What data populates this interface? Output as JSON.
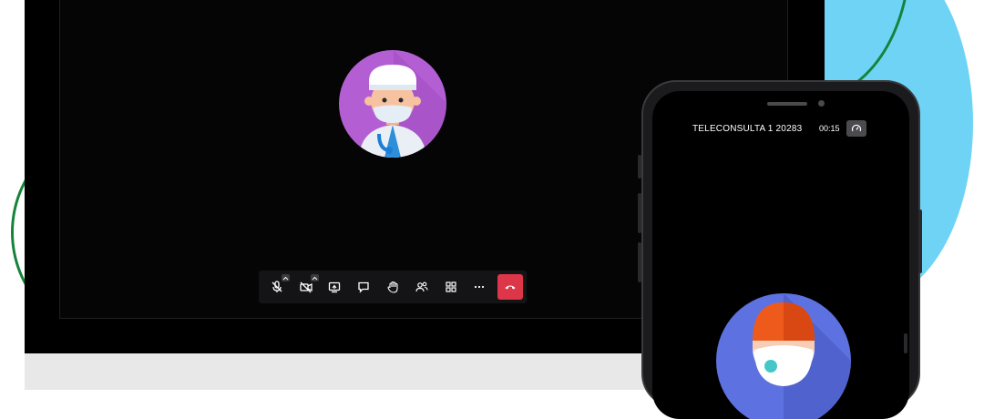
{
  "call": {
    "title": "TELECONSULTA 1 20283",
    "timer": "00:15"
  },
  "toolbar": {
    "buttons": [
      {
        "name": "microphone-muted",
        "icon": "mic-off-icon",
        "has_caret": true
      },
      {
        "name": "camera-off",
        "icon": "video-off-icon",
        "has_caret": true
      },
      {
        "name": "share-screen",
        "icon": "screen-share-icon",
        "has_caret": false
      },
      {
        "name": "chat",
        "icon": "chat-icon",
        "has_caret": false
      },
      {
        "name": "raise-hand",
        "icon": "hand-icon",
        "has_caret": false
      },
      {
        "name": "participants",
        "icon": "participants-icon",
        "has_caret": false
      },
      {
        "name": "tile-view",
        "icon": "grid-icon",
        "has_caret": false
      },
      {
        "name": "more",
        "icon": "more-icon",
        "has_caret": false
      }
    ],
    "end_call_icon": "hangup-icon"
  },
  "colors": {
    "accent_blue": "#6fd3f5",
    "accent_green": "#15833a",
    "end_call_red": "#dd3649",
    "doctor_avatar_bg": "#b35fd3",
    "patient_avatar_bg": "#5d71e0"
  }
}
